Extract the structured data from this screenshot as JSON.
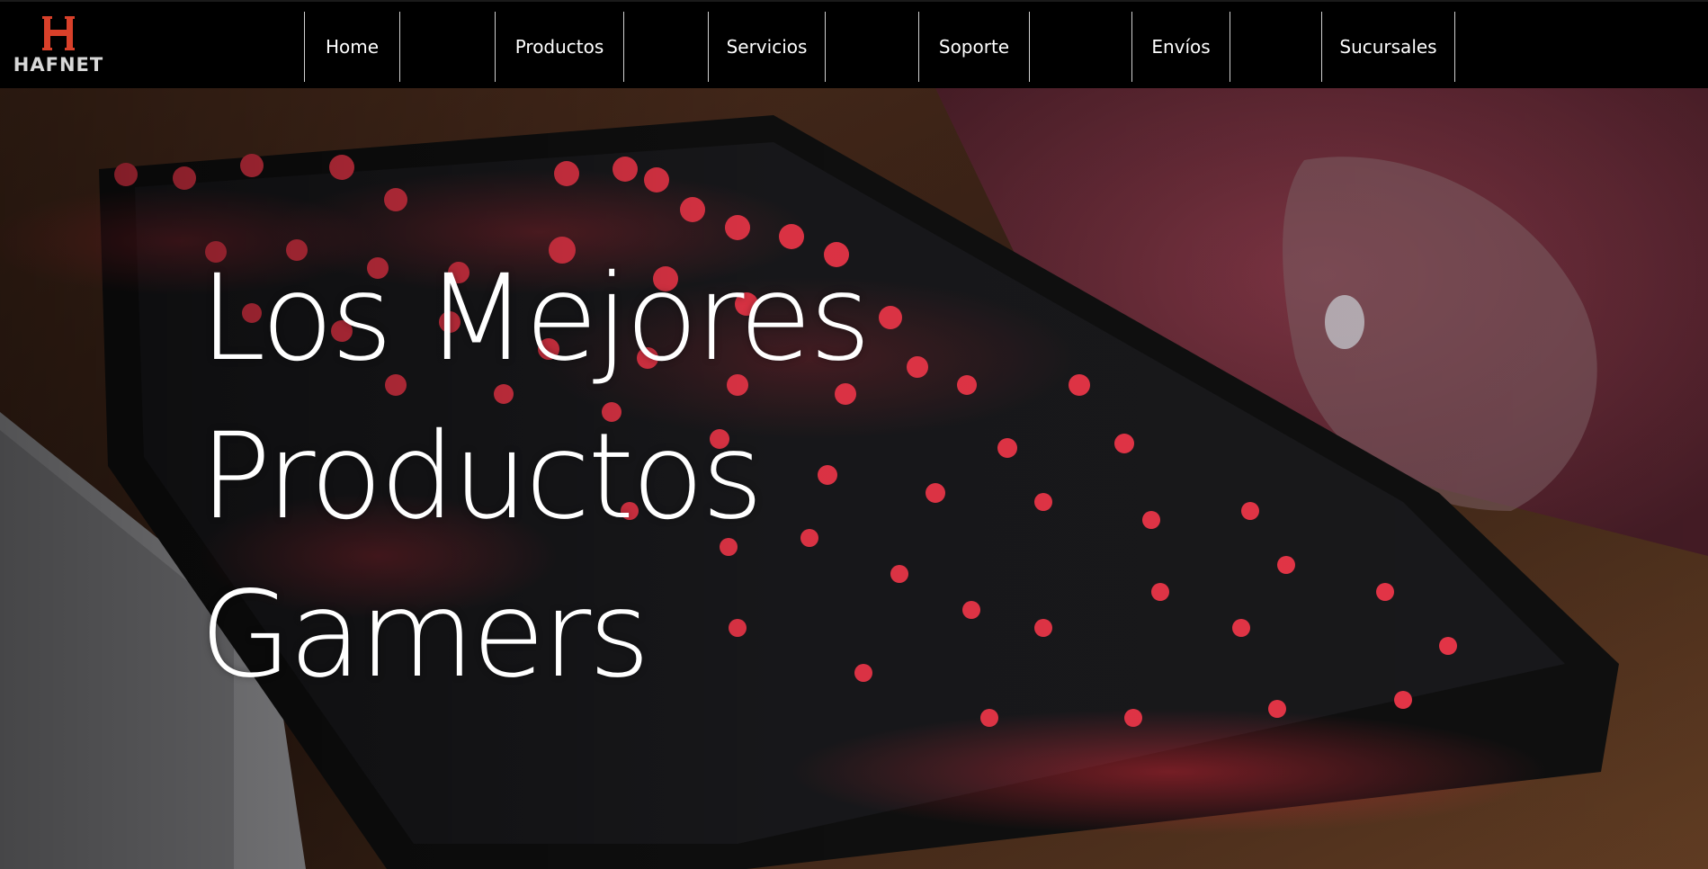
{
  "brand": {
    "name": "HAFNET",
    "mark_letter": "H",
    "accent_color": "#d8402a"
  },
  "nav": {
    "items": [
      {
        "label": "Home"
      },
      {
        "label": "Productos"
      },
      {
        "label": "Servicios"
      },
      {
        "label": "Soporte"
      },
      {
        "label": "Envíos"
      },
      {
        "label": "Sucursales"
      }
    ]
  },
  "hero": {
    "title_lines": [
      "Los Mejores",
      "Productos",
      "Gamers"
    ],
    "background": "keyboard-photo",
    "backlight_color": "#ff2a3a"
  }
}
